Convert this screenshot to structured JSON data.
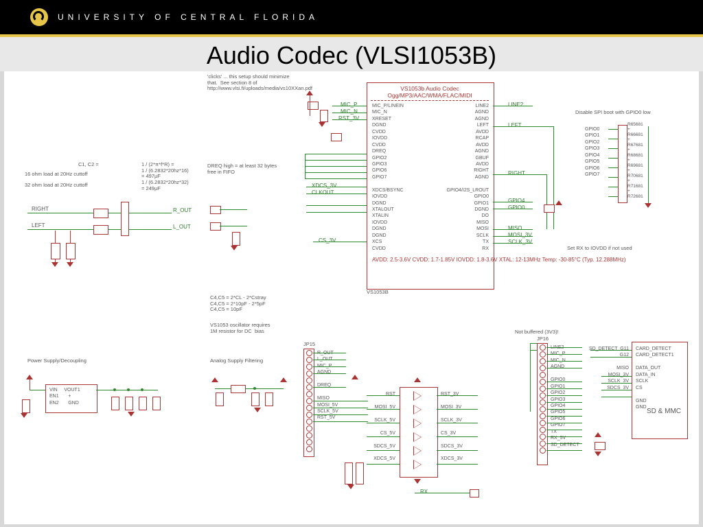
{
  "header": {
    "university": "UNIVERSITY OF CENTRAL FLORIDA"
  },
  "title": "Audio Codec (VLSI1053B)",
  "notes": {
    "clicks": "'clicks' ... this setup should minimize\nthat.  See section 8 of\nhttp://www.vlsi.fi/uploads/media/vs10XXan.pdf",
    "c1c2_heading": "C1, C2 =",
    "c1c2_sub1": "16 ohm load at 20Hz cuttoff",
    "c1c2_sub2": "32 ohm load at 20Hz cuttoff",
    "c1c2_eq": "1 / (2*π*f*R) =\n1 / (6.2832*20hz*16)\n= 497µF\n1 / (6.2832*20hz*32)\n= 249µF",
    "dreq": "DREQ high = at least 32 bytes\nfree in FIFO",
    "c4c5": "C4,C5 = 2*CL - 2*Cstray\nC4,C5 = 2*10pF - 2*5pF\nC4,C5 = 10pF",
    "osc": "VS1053 oscillator requires\n1M resistor for DC  bias",
    "power": "Power Supply/Decoupling",
    "analog": "Analog Supply Filtering",
    "notbuffered": "Not buffered (3V3)!",
    "disable_spi": "Disable SPI boot with GPIO0 low",
    "setrx": "Set RX to IOVDD if not used"
  },
  "chip": {
    "title": "VS1053b Audio Codec\nOgg/MP3/AAC/WMA/FLAC/MIDI",
    "name": "VS1053B",
    "left_pins": "MIC_P/LINEIN\nMIC_N\nXRESET\nDGND\nCVDD\nIOVDD\nCVDD\nDREQ\nGPIO2\nGPIO3\nGPIO6\nGPIO7\n\nXDCS/BSYNC\nIOVDD\nDGND\nXTALOUT\nXTALIN\nIOVDD\nDGND\nDGND\nXCS\nCVDD",
    "right_pins": "LINE2\nAGND\nAGND\nLEFT\nAVDD\nRCAP\nAVDD\nAGND\nGBUF\nAVDD\nRIGHT\nAGND\n\nGPIO4/I2S_LROUT\nGPIO0\nGPIO1\nDGND\nDO\nMISO\nMOSI\nSCLK\nTX\nRX",
    "specs": "AVDD:  2.5-3.6V      CVDD:  1.7-1.85V\nIOVDD:  1.8-3.6V     XTAL:  12-13MHz\nTemp:      -30-85°C       (Typ. 12.288MHz)"
  },
  "sigs": {
    "mic_p": "MIC_P",
    "mic_n": "MIC_N",
    "rst_3v": "RST_3V",
    "xdcs_3v": "XDCS_3V",
    "clkout": "CLKOUT",
    "cs_3v": "CS_3V",
    "line2": "LINE2",
    "left": "LEFT",
    "right": "RIGHT",
    "gpio4": "GPIO4",
    "gpio0": "GPIO0",
    "miso": "MISO",
    "mosi_3v": "MOSI_3V",
    "sclk_3v": "SCLK_3V",
    "r_out": "R_OUT",
    "l_out": "L_OUT",
    "rx": "RX",
    "tx": "TX"
  },
  "jp15": {
    "name": "JP15",
    "pins": "R_OUT\nL_OUT\nMIC_P\nAGND\n\nDREQ\n\nMISO\nMOSI_5V\nSCLK_5V\nRST_5V"
  },
  "levelshift": {
    "in": "RST\n\nMOSI_5V\n\nSCLK_5V\n\nCS_5V\n\nSDCS_5V\n\nXDCS_5V",
    "out": "RST_3V\n\nMOSI_3V\n\nSCLK_3V\n\nCS_3V\n\nSDCS_3V\n\nXDCS_3V",
    "rx": "RX"
  },
  "jp16": {
    "name": "JP16",
    "pins": "LINE2\nMIC_P\nMIC_N\nAGND\n\nGPIO0\nGPIO1\nGPIO2\nGPIO3\nGPIO4\nGPIO5\nGPIO6\nGPIO7\nTX\nRX_5V\nSD_DETECT"
  },
  "gpio_bank": "GPIO0\nGPIO1\nGPIO2\nGPIO3\nGPIO4\nGPIO5\nGPIO6\nGPIO7",
  "gpio_res": "R65681\n+\nR66681\n+\nR67681\n+\nR68681\n+\nR69681\n+\nR70681\n+\nR71681\n+\nR72681",
  "sd": {
    "title": "SD & MMC",
    "right": "CARD_DETECT\nCARD_DETECT1\n\nDATA_OUT\nDATA_IN\nSCLK\nCS\n\nGND\nGND",
    "left": "SD_DETECT  G11\nG12\n\nMISO\nMOSI_3V\nSCLK_3V\nSDCS_3V"
  },
  "output": {
    "right": "RIGHT",
    "left": "LEFT",
    "rout": "R_OUT",
    "lout": "L_OUT"
  },
  "regulator": {
    "pins": "VIN     VOUT1\nEN1       +\nEN2       GND"
  }
}
